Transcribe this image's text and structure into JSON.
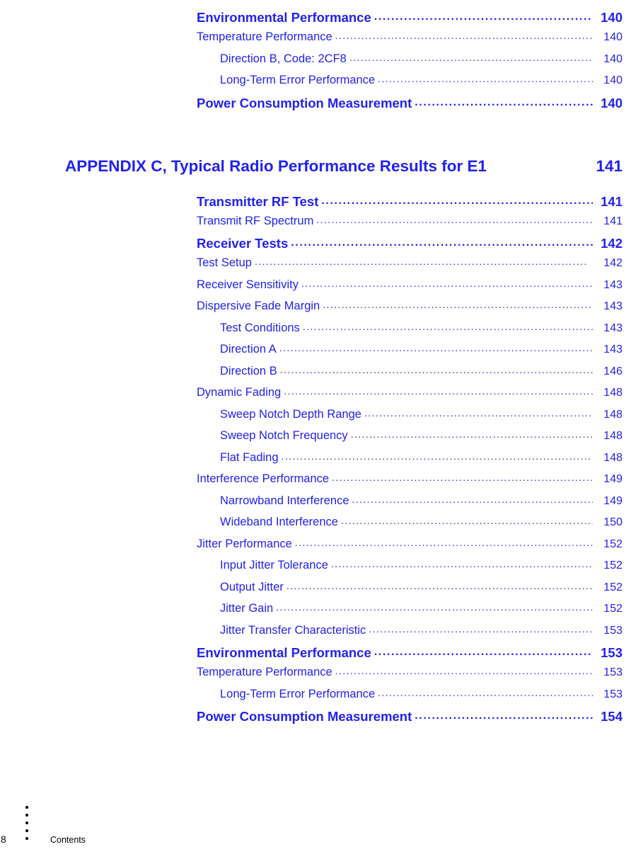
{
  "document": {
    "footer": {
      "folio": "8",
      "label": "Contents"
    }
  },
  "toc": {
    "top_entries": [
      {
        "level": 1,
        "label": "Environmental Performance",
        "page": "140"
      },
      {
        "level": 2,
        "label": "Temperature Performance",
        "page": "140"
      },
      {
        "level": 3,
        "label": "Direction B, Code: 2CF8",
        "page": "140"
      },
      {
        "level": 3,
        "label": "Long-Term Error Performance",
        "page": "140"
      },
      {
        "level": 1,
        "label": "Power Consumption Measurement",
        "page": "140"
      }
    ],
    "appendix": {
      "title": "APPENDIX C, Typical Radio Performance Results for E1",
      "page": "141"
    },
    "appendix_entries": [
      {
        "level": 1,
        "label": "Transmitter RF Test",
        "page": "141"
      },
      {
        "level": 2,
        "label": "Transmit RF Spectrum",
        "page": "141"
      },
      {
        "level": 1,
        "label": "Receiver Tests",
        "page": "142"
      },
      {
        "level": 2,
        "label": "Test Setup",
        "page": "142"
      },
      {
        "level": 2,
        "label": "Receiver Sensitivity",
        "page": "143"
      },
      {
        "level": 2,
        "label": "Dispersive Fade Margin",
        "page": "143"
      },
      {
        "level": 3,
        "label": "Test Conditions",
        "page": "143"
      },
      {
        "level": 3,
        "label": "Direction A",
        "page": "143"
      },
      {
        "level": 3,
        "label": "Direction B",
        "page": "146"
      },
      {
        "level": 2,
        "label": "Dynamic Fading",
        "page": "148"
      },
      {
        "level": 3,
        "label": "Sweep Notch Depth Range",
        "page": "148"
      },
      {
        "level": 3,
        "label": "Sweep Notch Frequency",
        "page": "148"
      },
      {
        "level": 3,
        "label": "Flat Fading",
        "page": "148"
      },
      {
        "level": 2,
        "label": "Interference Performance",
        "page": "149"
      },
      {
        "level": 3,
        "label": "Narrowband Interference",
        "page": "149"
      },
      {
        "level": 3,
        "label": "Wideband Interference",
        "page": "150"
      },
      {
        "level": 2,
        "label": "Jitter Performance",
        "page": "152"
      },
      {
        "level": 3,
        "label": "Input Jitter Tolerance",
        "page": "152"
      },
      {
        "level": 3,
        "label": "Output Jitter",
        "page": "152"
      },
      {
        "level": 3,
        "label": "Jitter Gain",
        "page": "152"
      },
      {
        "level": 3,
        "label": "Jitter Transfer Characteristic",
        "page": "153"
      },
      {
        "level": 1,
        "label": "Environmental Performance",
        "page": "153"
      },
      {
        "level": 2,
        "label": "Temperature Performance",
        "page": "153"
      },
      {
        "level": 3,
        "label": "Long-Term Error Performance",
        "page": "153"
      },
      {
        "level": 1,
        "label": "Power Consumption Measurement",
        "page": "154"
      }
    ],
    "leader_char": "."
  }
}
